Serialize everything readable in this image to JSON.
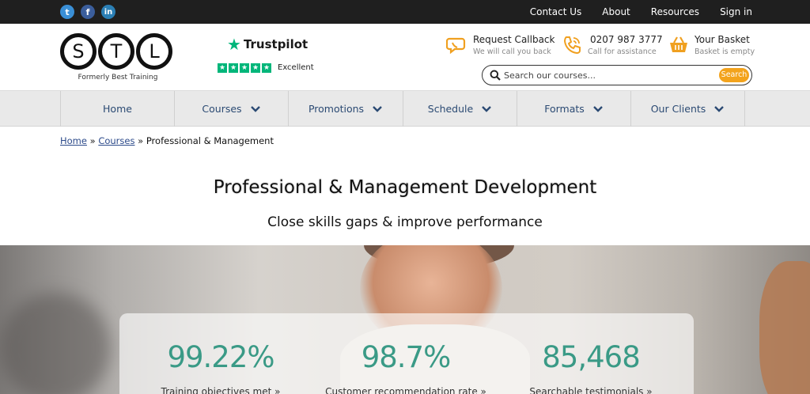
{
  "topbar": {
    "links": [
      "Contact Us",
      "About",
      "Resources",
      "Sign in"
    ]
  },
  "logo": {
    "letters": [
      "S",
      "T",
      "L"
    ],
    "tagline": "Formerly Best Training"
  },
  "trustpilot": {
    "name": "Trustpilot",
    "rating_label": "Excellent",
    "stars": 5
  },
  "header": {
    "callback": {
      "title": "Request Callback",
      "sub": "We will call you back"
    },
    "phone": {
      "title": "0207 987 3777",
      "sub": "Call for assistance"
    },
    "basket": {
      "title": "Your Basket",
      "sub": "Basket is empty"
    }
  },
  "search": {
    "placeholder": "Search our courses...",
    "button": "Search"
  },
  "nav": {
    "items": [
      {
        "label": "Home"
      },
      {
        "label": "Courses"
      },
      {
        "label": "Promotions"
      },
      {
        "label": "Schedule"
      },
      {
        "label": "Formats"
      },
      {
        "label": "Our Clients"
      }
    ]
  },
  "breadcrumb": {
    "home": "Home",
    "sep": "»",
    "courses": "Courses",
    "current": "Professional & Management"
  },
  "page": {
    "title": "Professional & Management Development",
    "subtitle": "Close skills gaps & improve performance"
  },
  "stats": [
    {
      "value": "99.22%",
      "label": "Training objectives met »"
    },
    {
      "value": "98.7%",
      "label": "Customer recommendation rate »"
    },
    {
      "value": "85,468",
      "label": "Searchable testimonials »"
    }
  ],
  "colors": {
    "accent_orange": "#f3a31c",
    "stat_green": "#3a9a86",
    "nav_text": "#2b4a73",
    "trustpilot_green": "#00b67a"
  }
}
